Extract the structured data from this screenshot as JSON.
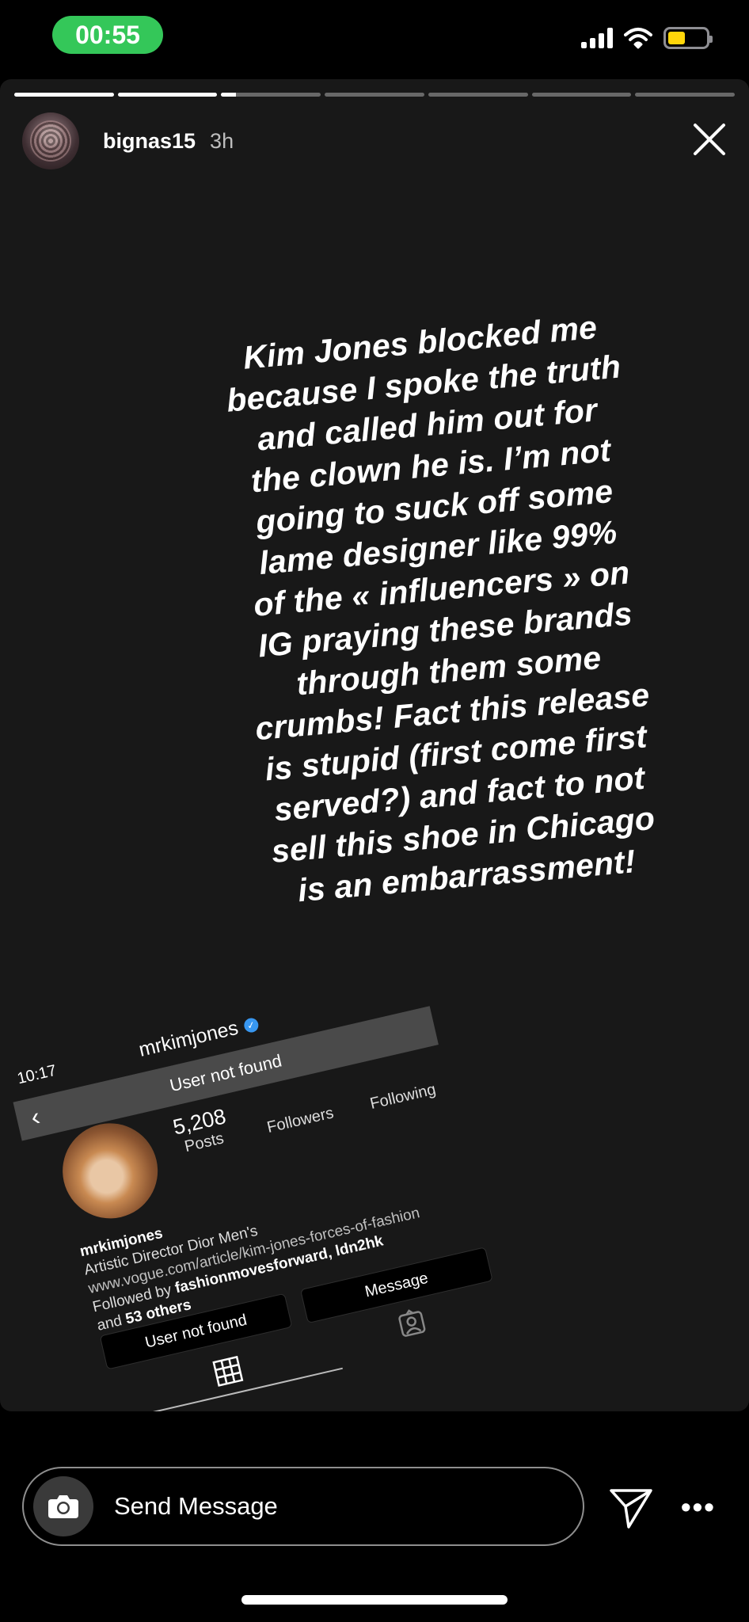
{
  "status_bar": {
    "time": "00:55",
    "battery_color": "#ffd60a",
    "time_pill_color": "#34c759"
  },
  "story": {
    "username": "bignas15",
    "time_ago": "3h",
    "segments_progress": [
      1,
      1,
      0.15,
      0,
      0,
      0,
      0
    ],
    "text": "Kim Jones blocked me because I spoke the truth and called him out for the clown he is. I’m not going to suck off some lame designer like 99% of the « influencers » on IG praying these brands through them some crumbs! Fact this release is stupid (first come first served?) and fact to not sell this shoe in Chicago is an embarrassment!"
  },
  "embedded_profile": {
    "time": "10:17",
    "handle": "mrkimjones",
    "banner": "User not found",
    "posts_count": "5,208",
    "posts_label": "Posts",
    "followers_label": "Followers",
    "following_label": "Following",
    "bio_name": "mrkimjones",
    "bio_title": "Artistic Director Dior Men's",
    "bio_link": "www.vogue.com/article/kim-jones-forces-of-fashion",
    "followed_by_prefix": "Followed by",
    "followed_by_names": "fashionmovesforward, ldn2hk",
    "followed_by_and": "and",
    "followed_by_others": "53 others",
    "button_follow": "User not found",
    "button_message": "Message"
  },
  "message_bar": {
    "placeholder": "Send Message"
  },
  "icons": [
    "camera-icon",
    "send-icon",
    "more-icon",
    "close-icon",
    "grid-icon",
    "tagged-icon",
    "back-chevron-icon",
    "verified-icon",
    "wifi-icon",
    "signal-icon",
    "battery-icon"
  ]
}
